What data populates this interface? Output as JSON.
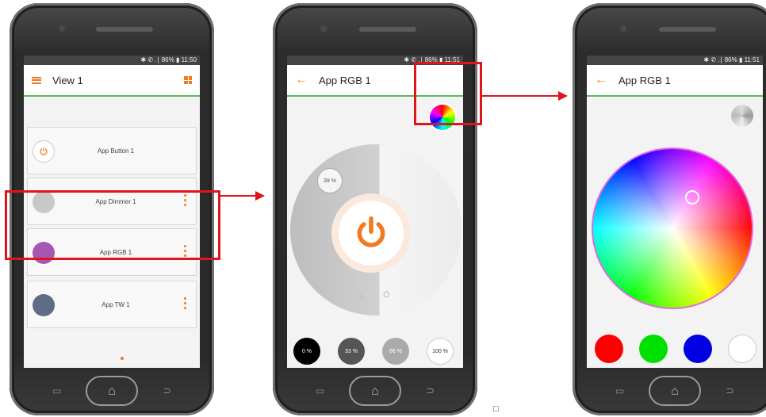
{
  "phone1": {
    "status": "✱ ✆ .∣ 86% ▮ 11:50",
    "title": "View 1",
    "cards": [
      {
        "label": "App Button 1",
        "icon": "power-icon",
        "dot_color": "#ffffff"
      },
      {
        "label": "App Dimmer 1",
        "dot_color": "#c8c8c8"
      },
      {
        "label": "App RGB 1",
        "dot_color": "#a657b4"
      },
      {
        "label": "App TW 1",
        "dot_color": "#5f6b87"
      }
    ]
  },
  "phone2": {
    "status": "✱ ✆ .∣ 86% ▮ 11:51",
    "title": "App RGB 1",
    "level_badge": "39 %",
    "presets": [
      "0 %",
      "33 %",
      "66 %",
      "100 %"
    ]
  },
  "phone3": {
    "status": "✱ ✆ .∣ 86% ▮ 11:51",
    "title": "App RGB 1",
    "swatches": [
      "#ff0000",
      "#00e000",
      "#0000e0",
      "#ffffff"
    ]
  },
  "nav": {
    "back": "←",
    "home": "⌂",
    "recent": "▭",
    "backkey": "⊃"
  },
  "accent_color": "#f07a22",
  "highlight_color": "#e0141a",
  "stray_glyph": "□"
}
